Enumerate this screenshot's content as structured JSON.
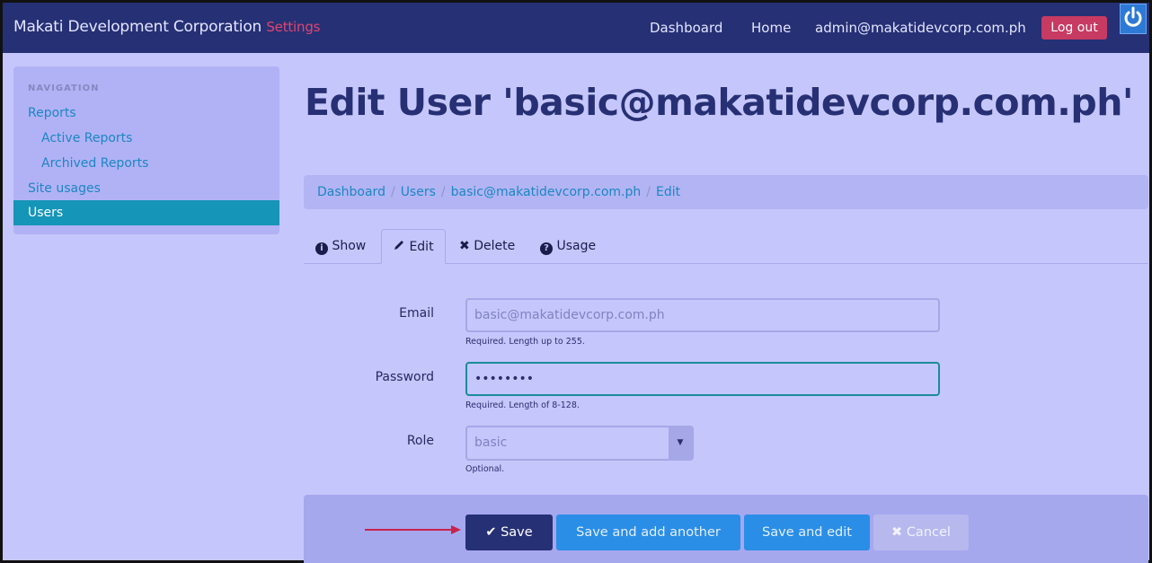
{
  "navbar": {
    "brand": "Makati Development Corporation",
    "brand_accent": "Settings",
    "links": [
      "Dashboard",
      "Home",
      "admin@makatidevcorp.com.ph"
    ],
    "logout_label": "Log out",
    "power_icon": "power-icon"
  },
  "sidebar": {
    "header": "NAVIGATION",
    "items": [
      {
        "label": "Reports"
      },
      {
        "label": "Active Reports"
      },
      {
        "label": "Archived Reports"
      },
      {
        "label": "Site usages"
      },
      {
        "label": "Users"
      }
    ]
  },
  "main": {
    "title": "Edit User 'basic@makatidevcorp.com.ph'",
    "breadcrumb": [
      "Dashboard",
      "Users",
      "basic@makatidevcorp.com.ph",
      "Edit"
    ],
    "tabs": [
      {
        "label": "Show",
        "icon": "info-icon"
      },
      {
        "label": "Edit",
        "icon": "pencil-icon"
      },
      {
        "label": "Delete",
        "icon": "x-icon"
      },
      {
        "label": "Usage",
        "icon": "question-icon"
      }
    ],
    "form": {
      "email": {
        "label": "Email",
        "value": "basic@makatidevcorp.com.ph",
        "help": "Required. Length up to 255."
      },
      "password": {
        "label": "Password",
        "value": "••••••••",
        "help": "Required. Length of 8-128."
      },
      "role": {
        "label": "Role",
        "value": "basic",
        "help": "Optional."
      }
    },
    "buttons": {
      "save": "Save",
      "save_add": "Save and add another",
      "save_edit": "Save and edit",
      "cancel": "Cancel"
    }
  },
  "colors": {
    "navbar": "#263075",
    "background": "#c5c6fb",
    "accent": "#e0456f",
    "active": "#1595b7",
    "primary_button": "#2a8ee6"
  }
}
